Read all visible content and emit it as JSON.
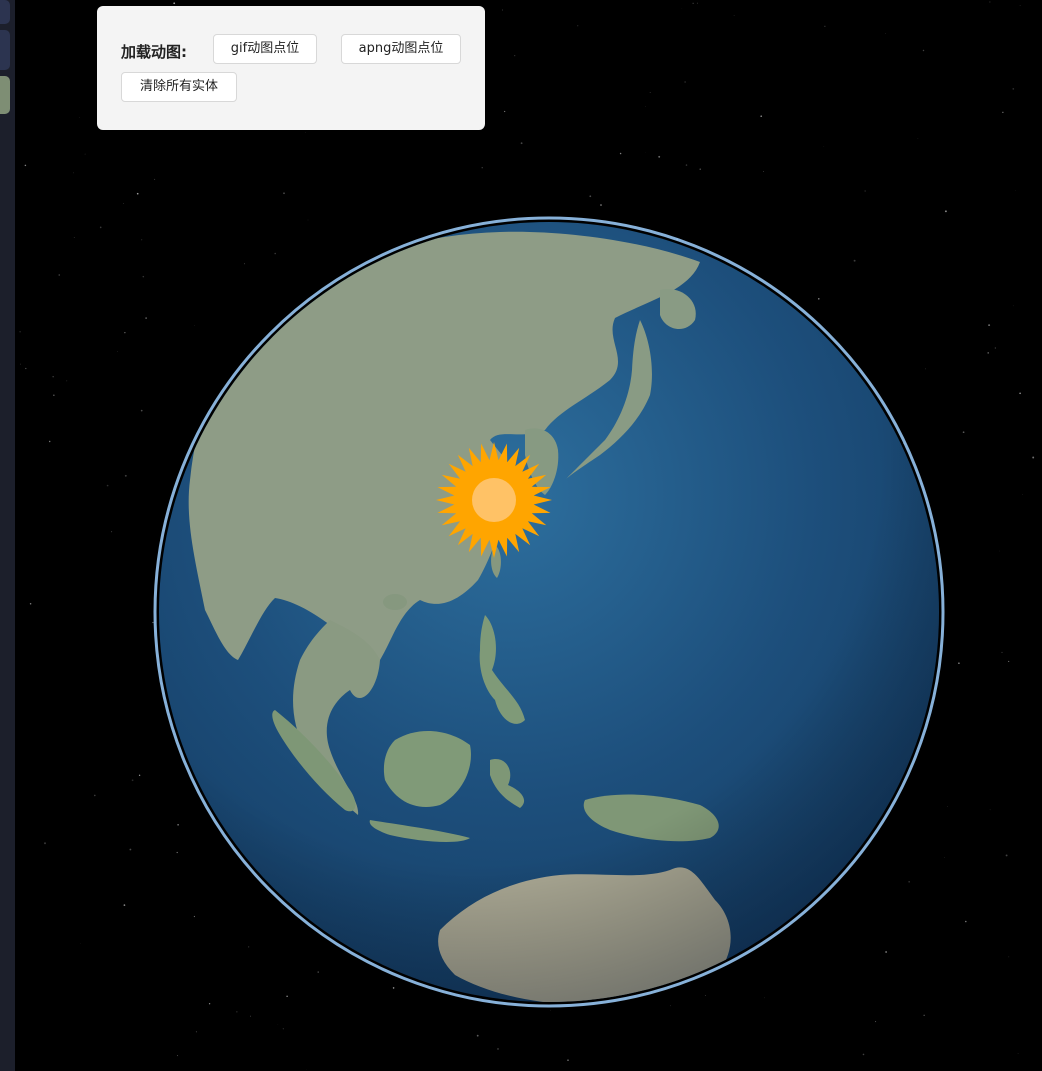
{
  "panel": {
    "label": "加载动图:",
    "buttons": {
      "gif": "gif动图点位",
      "apng": "apng动图点位",
      "clear": "清除所有实体"
    }
  },
  "map": {
    "view": "3d-globe",
    "centered_on": "East Asia",
    "marker_icon": "sun-icon",
    "marker_color": "#FFA500",
    "marker_core_color": "#FFC266"
  },
  "colors": {
    "ocean_deep": "#0f2f57",
    "ocean_shallow": "#2a6fa0",
    "land": "#8a9a80",
    "atmosphere": "#cfe7ff",
    "panel_bg": "#f4f4f4"
  }
}
